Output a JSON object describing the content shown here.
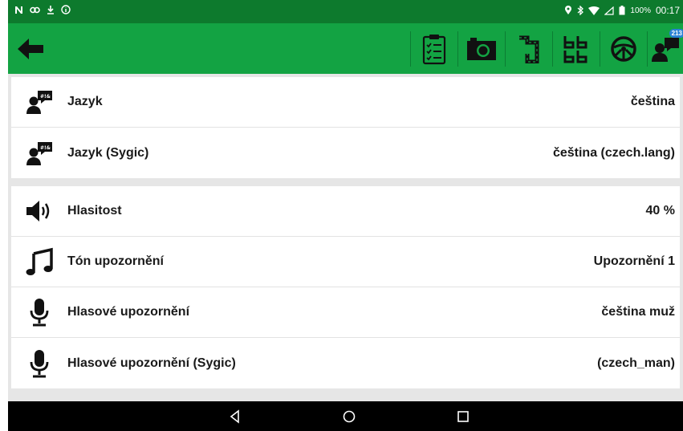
{
  "status_bar": {
    "left_icons": [
      "n-icon",
      "sync-icon",
      "download-icon",
      "info-icon"
    ],
    "battery": "100%",
    "time": "00:17"
  },
  "toolbar": {
    "buttons": [
      "checklist-icon",
      "camera-icon",
      "route-icon",
      "grid-icon",
      "steering-wheel-icon",
      "language-icon"
    ],
    "badge": "213"
  },
  "settings": [
    {
      "icon": "language-icon",
      "label": "Jazyk",
      "value": "čeština"
    },
    {
      "icon": "language-icon",
      "label": "Jazyk (Sygic)",
      "value": "čeština (czech.lang)"
    },
    {
      "icon": "volume-icon",
      "label": "Hlasitost",
      "value": "40 %"
    },
    {
      "icon": "music-note-icon",
      "label": "Tón upozornění",
      "value": "Upozornění 1"
    },
    {
      "icon": "microphone-icon",
      "label": "Hlasové upozornění",
      "value": "čeština muž"
    },
    {
      "icon": "microphone-icon",
      "label": "Hlasové upozornění (Sygic)",
      "value": "(czech_man)"
    }
  ],
  "colors": {
    "status_bar": "#0d7a2d",
    "toolbar": "#13a343",
    "background": "#e6e6e6",
    "nav_bar": "#000000"
  }
}
